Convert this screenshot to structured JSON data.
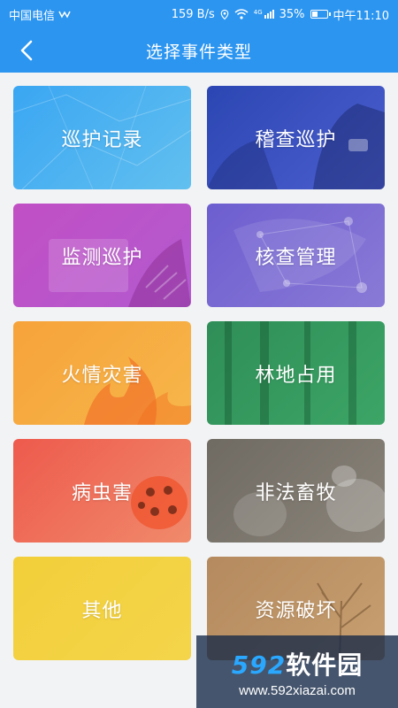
{
  "status_bar": {
    "carrier": "中国电信",
    "network_speed": "159 B/s",
    "signal_label": "4G",
    "battery_percent": "35%",
    "time": "中午11:10"
  },
  "header": {
    "title": "选择事件类型",
    "back_icon": "chevron-left-icon"
  },
  "event_types": [
    {
      "label": "巡护记录"
    },
    {
      "label": "稽查巡护"
    },
    {
      "label": "监测巡护"
    },
    {
      "label": "核查管理"
    },
    {
      "label": "火情灾害"
    },
    {
      "label": "林地占用"
    },
    {
      "label": "病虫害"
    },
    {
      "label": "非法畜牧"
    },
    {
      "label": "其他"
    },
    {
      "label": "资源破坏"
    }
  ],
  "watermark": {
    "brand_number": "592",
    "brand_text": "软件园",
    "url": "www.592xiazai.com"
  },
  "colors": {
    "header": "#2b95f0",
    "background": "#f2f3f5"
  }
}
